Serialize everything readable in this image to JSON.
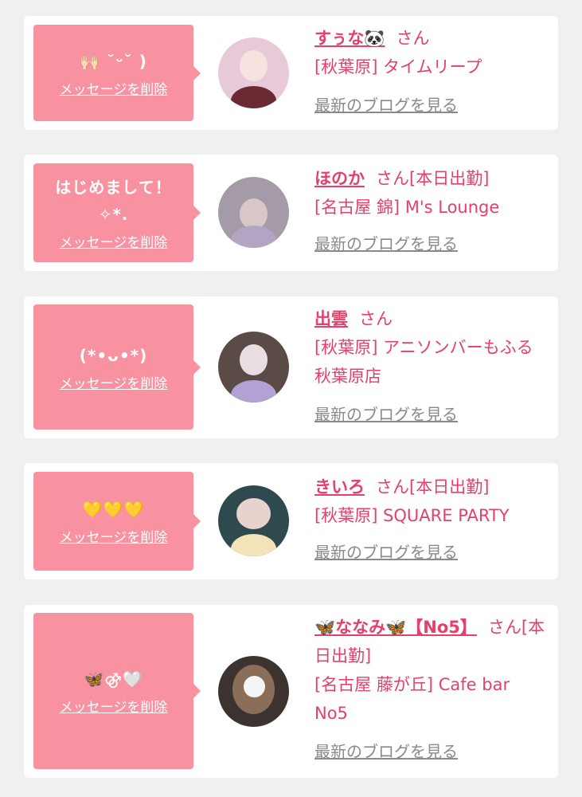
{
  "colors": {
    "accent": "#e4406a",
    "bubble": "#f892a0",
    "background": "#f0f0f0"
  },
  "delete_label": "メッセージを削除",
  "blog_label": "最新のブログを見る",
  "items": [
    {
      "message": "🙌🏻 ˘ᵕ˘ )",
      "name": "すぅな🐼",
      "honorific": "さん",
      "status": "",
      "shop": "[秋葉原] タイムリープ",
      "avatar_colors": [
        "#e7c9d7",
        "#6a2a33",
        "#f1d6df"
      ]
    },
    {
      "message": "はじめまして！✧︎*.",
      "name": "ほのか",
      "honorific": "さん",
      "status": "[本日出勤]",
      "shop": "[名古屋 錦] M's Lounge",
      "avatar_colors": [
        "#a59aa7",
        "#d9c7c7",
        "#b3a4c3"
      ]
    },
    {
      "message": "(*•ᴗ•*)",
      "name": "出雲",
      "honorific": "さん",
      "status": "",
      "shop": "[秋葉原] アニソンバーもふる 秋葉原店",
      "avatar_colors": [
        "#5a4b47",
        "#e9dfe3",
        "#b2a2d3"
      ]
    },
    {
      "message": "💛💛💛",
      "name": "きいろ",
      "honorific": "さん",
      "status": "[本日出勤]",
      "shop": "[秋葉原] SQUARE PARTY",
      "avatar_colors": [
        "#2e4a4f",
        "#f2e3b8",
        "#e8d2cd"
      ]
    },
    {
      "message": "🦋⚣🤍",
      "name": "🦋ななみ🦋【No5】",
      "honorific": "さん",
      "status": "[本日出勤]",
      "shop": "[名古屋 藤が丘] Cafe bar No5",
      "avatar_colors": [
        "#3c3331",
        "#f5f5f5",
        "#8a6e59"
      ]
    }
  ]
}
